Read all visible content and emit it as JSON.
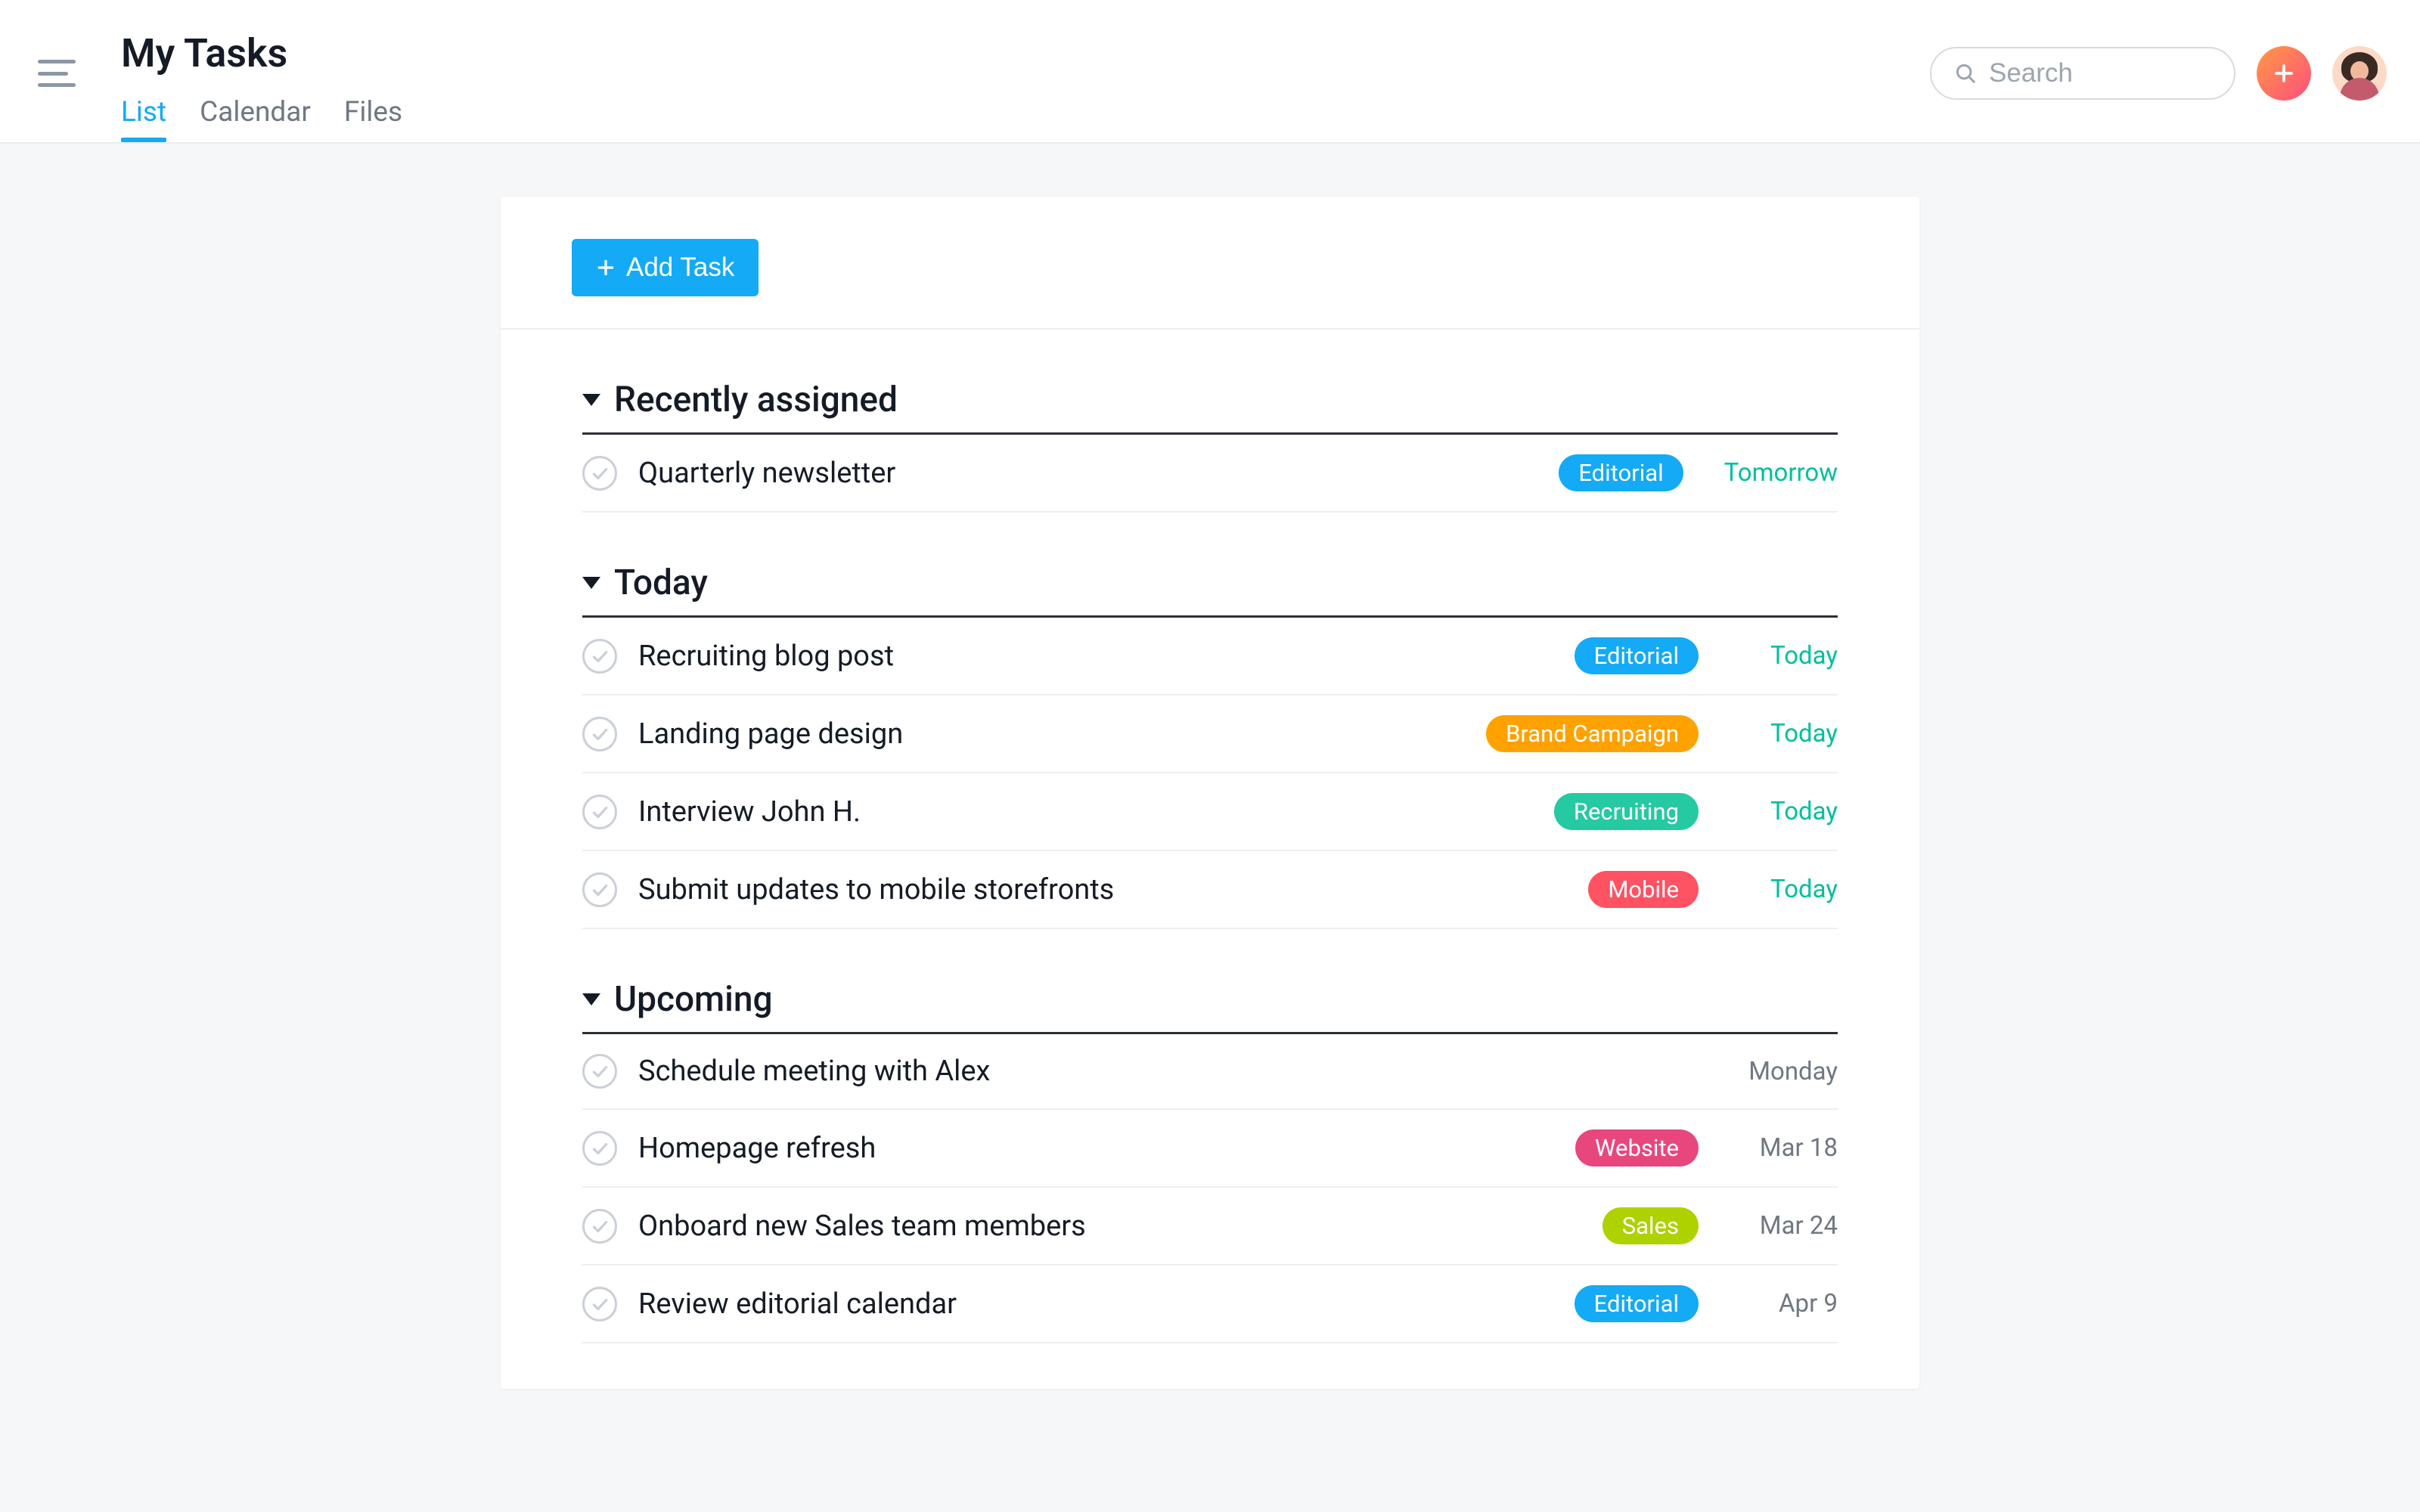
{
  "header": {
    "title": "My Tasks",
    "tabs": [
      "List",
      "Calendar",
      "Files"
    ],
    "active_tab": 0
  },
  "search": {
    "placeholder": "Search"
  },
  "toolbar": {
    "add_task_label": "Add Task"
  },
  "tag_colors": {
    "Editorial": "#14aaf5",
    "Brand Campaign": "#ffa200",
    "Recruiting": "#25c9a2",
    "Mobile": "#ff5263",
    "Website": "#e8477d",
    "Sales": "#aed100"
  },
  "sections": [
    {
      "title": "Recently assigned",
      "tasks": [
        {
          "name": "Quarterly newsletter",
          "tag": "Editorial",
          "due": "Tomorrow",
          "due_style": "green"
        }
      ]
    },
    {
      "title": "Today",
      "tasks": [
        {
          "name": "Recruiting blog post",
          "tag": "Editorial",
          "due": "Today",
          "due_style": "green"
        },
        {
          "name": "Landing page design",
          "tag": "Brand Campaign",
          "due": "Today",
          "due_style": "green"
        },
        {
          "name": "Interview John H.",
          "tag": "Recruiting",
          "due": "Today",
          "due_style": "green"
        },
        {
          "name": "Submit updates to mobile storefronts",
          "tag": "Mobile",
          "due": "Today",
          "due_style": "green"
        }
      ]
    },
    {
      "title": "Upcoming",
      "tasks": [
        {
          "name": "Schedule meeting with Alex",
          "tag": null,
          "due": "Monday",
          "due_style": "gray"
        },
        {
          "name": "Homepage refresh",
          "tag": "Website",
          "due": "Mar 18",
          "due_style": "gray"
        },
        {
          "name": "Onboard new Sales team members",
          "tag": "Sales",
          "due": "Mar 24",
          "due_style": "gray"
        },
        {
          "name": "Review editorial calendar",
          "tag": "Editorial",
          "due": "Apr 9",
          "due_style": "gray"
        }
      ]
    }
  ]
}
